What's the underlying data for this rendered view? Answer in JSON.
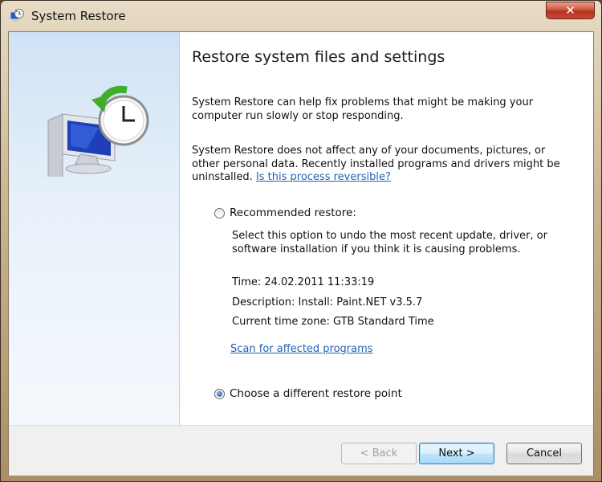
{
  "window": {
    "title": "System Restore",
    "close_symbol": "✕"
  },
  "content": {
    "heading": "Restore system files and settings",
    "para1": "System Restore can help fix problems that might be making your computer run slowly or stop responding.",
    "para2_text": "System Restore does not affect any of your documents, pictures, or other personal data. Recently installed programs and drivers might be uninstalled.",
    "reversible_link": "Is this process reversible?",
    "recommended": {
      "label": "Recommended restore:",
      "checked": false,
      "description": "Select this option to undo the most recent update, driver, or software installation if you think it is causing problems.",
      "time": "Time: 24.02.2011 11:33:19",
      "desc": "Description: Install: Paint.NET v3.5.7",
      "timezone": "Current time zone: GTB Standard Time",
      "scan_link": "Scan for affected programs"
    },
    "different": {
      "label": "Choose a different restore point",
      "checked": true
    }
  },
  "buttons": {
    "back": "< Back",
    "next": "Next >",
    "cancel": "Cancel"
  },
  "icons": {
    "app": "system-restore-icon",
    "hero": "computer-with-clock-restore-icon",
    "close": "close-icon"
  },
  "colors": {
    "link": "#1f62b5",
    "panel": "#cfe2f5",
    "close_button": "#c9493a"
  }
}
